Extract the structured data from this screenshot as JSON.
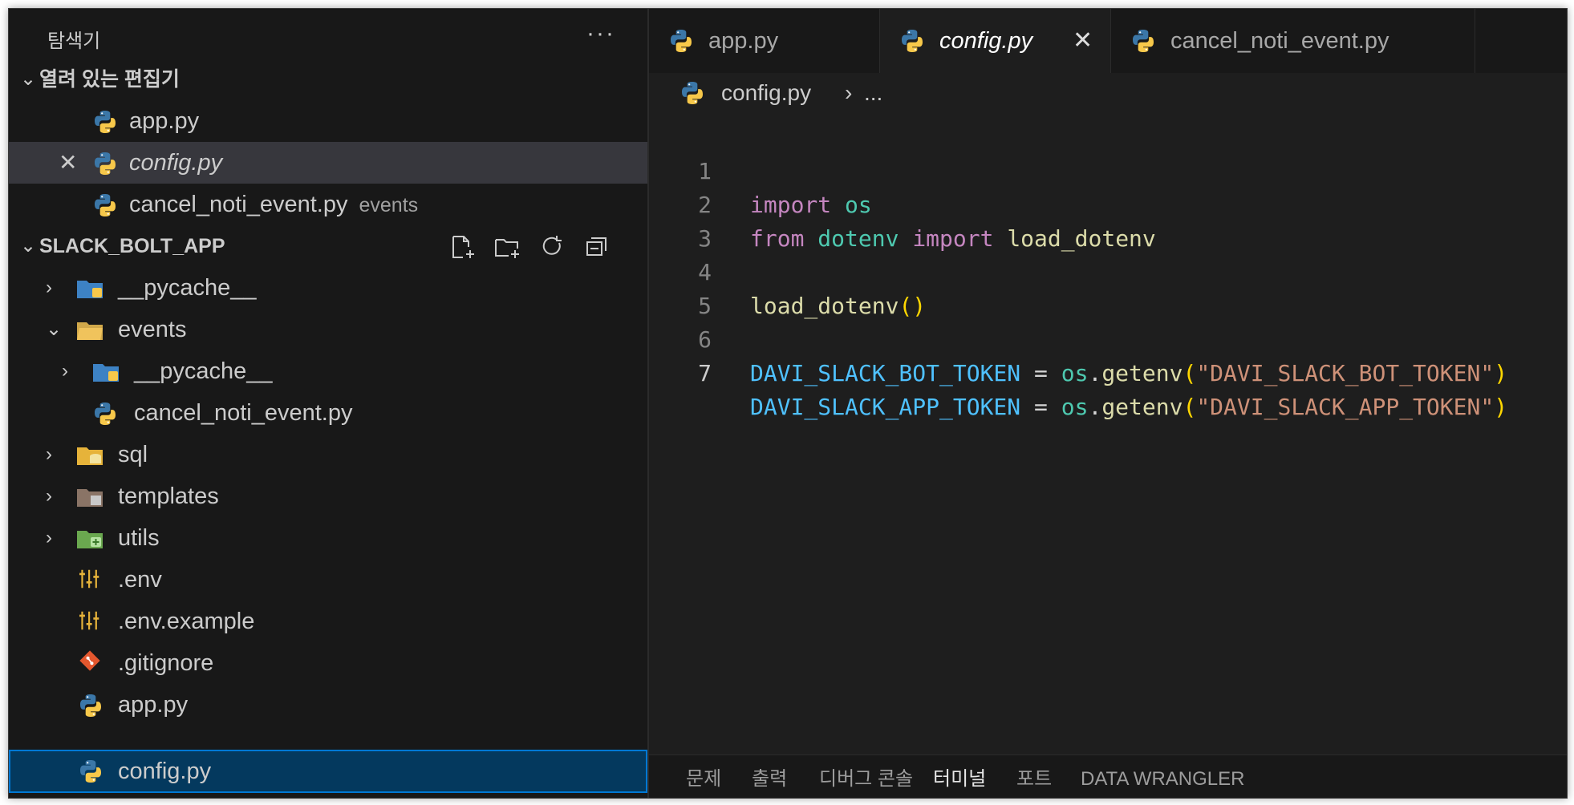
{
  "sidebar": {
    "title": "탐색기",
    "more": "···",
    "open_editors": {
      "title": "열려 있는 편집기",
      "items": [
        {
          "label": "app.py"
        },
        {
          "label": "config.py"
        },
        {
          "label": "cancel_noti_event.py",
          "desc": "events"
        }
      ]
    },
    "project": {
      "title": "SLACK_BOLT_APP",
      "tree": [
        {
          "label": "__pycache__"
        },
        {
          "label": "events"
        },
        {
          "label": "__pycache__"
        },
        {
          "label": "cancel_noti_event.py"
        },
        {
          "label": "sql"
        },
        {
          "label": "templates"
        },
        {
          "label": "utils"
        },
        {
          "label": ".env"
        },
        {
          "label": ".env.example"
        },
        {
          "label": ".gitignore"
        },
        {
          "label": "app.py"
        },
        {
          "label": "config.py"
        }
      ]
    }
  },
  "tabs": [
    {
      "label": "app.py"
    },
    {
      "label": "config.py"
    },
    {
      "label": "cancel_noti_event.py"
    }
  ],
  "breadcrumb": {
    "file": "config.py",
    "sep": "›",
    "rest": "..."
  },
  "code": {
    "line_numbers": [
      "1",
      "2",
      "3",
      "4",
      "5",
      "6",
      "7"
    ],
    "lines": [
      [
        "import",
        "os"
      ],
      [
        "from",
        "dotenv",
        "import",
        "load_dotenv"
      ],
      [],
      [
        "load_dotenv",
        "()"
      ],
      [],
      [
        "DAVI_SLACK_BOT_TOKEN",
        "=",
        "os",
        ".",
        "getenv",
        "(",
        "\"DAVI_SLACK_BOT_TOKEN\"",
        ")"
      ],
      [
        "DAVI_SLACK_APP_TOKEN",
        "=",
        "os",
        ".",
        "getenv",
        "(",
        "\"DAVI_SLACK_APP_TOKEN\"",
        ")"
      ]
    ]
  },
  "panel_tabs": [
    "문제",
    "출력",
    "디버그 콘솔",
    "터미널",
    "포트",
    "DATA WRANGLER"
  ],
  "colors": {
    "accent": "#0078d4",
    "keyword": "#c586c0",
    "module": "#4ec9b0",
    "function": "#dcdcaa",
    "variable": "#4fc1ff",
    "string": "#ce9178"
  }
}
